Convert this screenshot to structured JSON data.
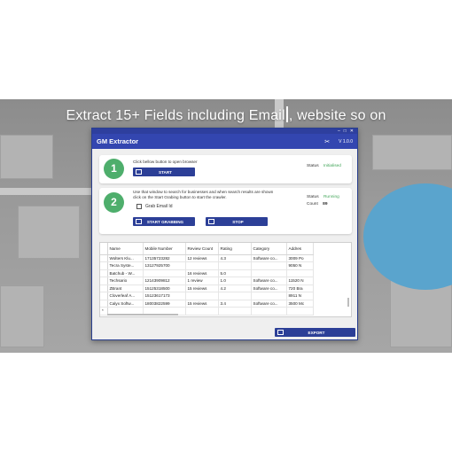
{
  "headline": {
    "before_cursor": "Extract 15+ Fields including Email",
    "after_cursor": "website so on"
  },
  "window": {
    "title": "GM Extractor",
    "version": "V 1.0.0",
    "sysbar": {
      "minimize": "–",
      "maximize": "□",
      "close": "✕"
    },
    "tools_icon": "tools-icon"
  },
  "step1": {
    "number": "1",
    "instruction": "Click bellow button to open browser",
    "button_label": "START",
    "status_label": "Status",
    "status_value": "Initialised"
  },
  "step2": {
    "number": "2",
    "instruction_line1": "Use that window to search for businesses and when search results are shown",
    "instruction_line2": "click on the Start Grabing button to start the crawler.",
    "checkbox_label": "Grab Email Id",
    "checkbox_checked": false,
    "start_button_label": "START GRABBING",
    "stop_button_label": "STOP",
    "status_label": "Status",
    "status_value": "Running",
    "count_label": "Count",
    "count_value": "89"
  },
  "table": {
    "columns": [
      "Name",
      "Mobile Number",
      "Review Count",
      "Rating",
      "Category",
      "Addres"
    ],
    "rows": [
      [
        "Wolters Klu...",
        "17135723282",
        "12 reviews",
        "4.3",
        "Software co...",
        "3009 Po"
      ],
      [
        "Tecra Syste...",
        "13127925700",
        "",
        "",
        "",
        "9050 N"
      ],
      [
        "Batchub - W...",
        "",
        "16 reviews",
        "5.0",
        "",
        ""
      ],
      [
        "Techsario",
        "12143909812",
        "1 review",
        "1.0",
        "Software co...",
        "11520 N"
      ],
      [
        "ZBrant",
        "15125318500",
        "15 reviews",
        "4.2",
        "Software co...",
        "720 Bra"
      ],
      [
        "Cloverleaf A...",
        "15123617173",
        "",
        "",
        "",
        "8911 N"
      ],
      [
        "Calyx Softw...",
        "18003822599",
        "15 reviews",
        "3.4",
        "Software co...",
        "3500 Mc"
      ]
    ],
    "new_row_marker": "*"
  },
  "export_button_label": "EXPORT",
  "colors": {
    "title_bar": "#3346b0",
    "button": "#2c3f97",
    "step_circle": "#4eae6c",
    "status_green": "#43a65a"
  }
}
